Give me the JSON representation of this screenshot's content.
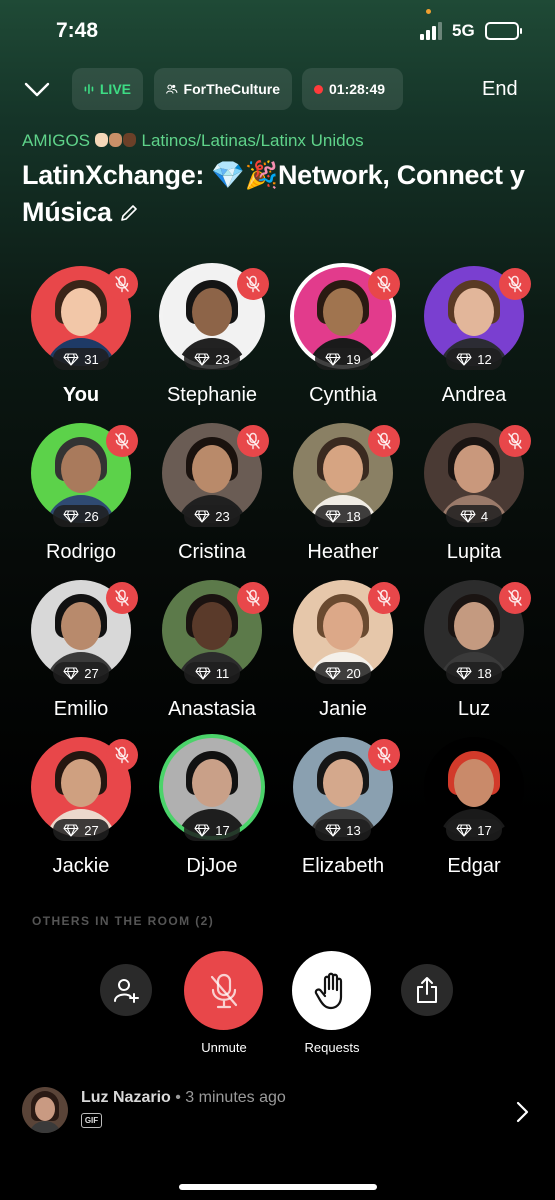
{
  "status_bar": {
    "time": "7:48",
    "network": "5G"
  },
  "header": {
    "live_label": "LIVE",
    "club_name": "ForTheCulture",
    "timer": "01:28:49",
    "end_label": "End"
  },
  "room": {
    "club_prefix": "AMIGOS",
    "club_suffix": "Latinos/Latinas/Latinx Unidos",
    "title": "LatinXchange: 💎🎉Network, Connect y Música"
  },
  "speakers": [
    {
      "name": "You",
      "gems": "31",
      "muted": true
    },
    {
      "name": "Stephanie",
      "gems": "23",
      "muted": true
    },
    {
      "name": "Cynthia",
      "gems": "19",
      "muted": true
    },
    {
      "name": "Andrea",
      "gems": "12",
      "muted": true
    },
    {
      "name": "Rodrigo",
      "gems": "26",
      "muted": true
    },
    {
      "name": "Cristina",
      "gems": "23",
      "muted": true
    },
    {
      "name": "Heather",
      "gems": "18",
      "muted": true
    },
    {
      "name": "Lupita",
      "gems": "4",
      "muted": true
    },
    {
      "name": "Emilio",
      "gems": "27",
      "muted": true
    },
    {
      "name": "Anastasia",
      "gems": "11",
      "muted": true
    },
    {
      "name": "Janie",
      "gems": "20",
      "muted": true
    },
    {
      "name": "Luz",
      "gems": "18",
      "muted": true
    },
    {
      "name": "Jackie",
      "gems": "27",
      "muted": true
    },
    {
      "name": "DjJoe",
      "gems": "17",
      "muted": false
    },
    {
      "name": "Elizabeth",
      "gems": "13",
      "muted": true
    },
    {
      "name": "Edgar",
      "gems": "17",
      "muted": false
    }
  ],
  "others_label": "OTHERS IN THE ROOM (2)",
  "controls": {
    "unmute_label": "Unmute",
    "requests_label": "Requests"
  },
  "chat": {
    "author": "Luz Nazario",
    "meta": "3 minutes ago",
    "attachment": "GIF"
  },
  "colors": {
    "accent_green": "#3ddc84",
    "club_green": "#5fd38a",
    "mute_red": "#e8474a"
  }
}
